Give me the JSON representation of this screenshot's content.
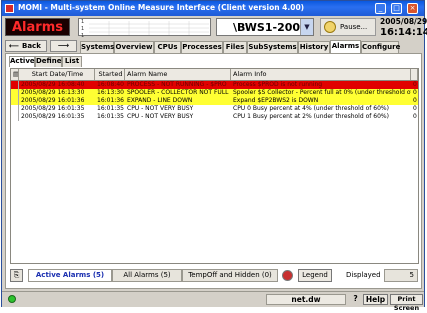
{
  "window": {
    "title": "MOMI - Multi-system Online Measure Interface (Client version 4.00)",
    "controls": {
      "minimize": "_",
      "maximize": "□",
      "close": "×"
    }
  },
  "header": {
    "alarms_label": "Alarms",
    "host": "\\BWS1-2004",
    "pause_label": "Pause...",
    "date": "2005/08/29",
    "time": "16:14:14",
    "graph_axis": [
      "1",
      "",
      "1",
      "",
      "1"
    ]
  },
  "nav": {
    "back_label": "Back",
    "tabs": [
      "Systems",
      "Overview",
      "CPUs",
      "Processes",
      "Files",
      "SubSystems",
      "History",
      "Alarms",
      "Configure"
    ],
    "active_tab": "Alarms"
  },
  "subtabs": {
    "items": [
      "Active",
      "Define",
      "List"
    ],
    "active": "Active"
  },
  "table": {
    "columns": [
      "Start Date/Time",
      "Started",
      "Alarm Name",
      "Alarm Info"
    ],
    "rows": [
      {
        "start": "2005/08/29 16:08:40",
        "started": "16:08:40",
        "name": "PROCESS - NOT RUNNING - $PRO",
        "info": "Process $PROD is not running",
        "count": "0",
        "color": "#e10000",
        "text_color": "#6a0000"
      },
      {
        "start": "2005/08/29 16:13:30",
        "started": "16:13:30",
        "name": "SPOOLER - COLLECTOR NOT FULL",
        "info": "Spooler $S Collector - Percent full at 0% (under threshold of 1%)",
        "count": "0",
        "color": "#ffff33",
        "text_color": "#000000"
      },
      {
        "start": "2005/08/29 16:01:36",
        "started": "16:01:36",
        "name": "EXPAND - LINE DOWN",
        "info": "Expand $EP2BWS2 is DOWN",
        "count": "0",
        "color": "#ffff33",
        "text_color": "#000000"
      },
      {
        "start": "2005/08/29 16:01:35",
        "started": "16:01:35",
        "name": "CPU - NOT VERY BUSY",
        "info": "CPU 0 Busy percent at 4% (under threshold of 60%)",
        "count": "0",
        "color": "#ffffff",
        "text_color": "#000000"
      },
      {
        "start": "2005/08/29 16:01:35",
        "started": "16:01:35",
        "name": "CPU - NOT VERY BUSY",
        "info": "CPU 1 Busy percent at 2% (under threshold of 60%)",
        "count": "0",
        "color": "#ffffff",
        "text_color": "#000000"
      }
    ]
  },
  "bottom": {
    "tabs": [
      "Active Alarms (5)",
      "All Alarms (5)",
      "TempOff and Hidden (0)"
    ],
    "legend_label": "Legend",
    "displayed_label": "Displayed",
    "displayed_count": "5"
  },
  "status": {
    "host": "net.dw",
    "help_q": "?",
    "help_label": "Help",
    "print_label": "Print Screen"
  }
}
